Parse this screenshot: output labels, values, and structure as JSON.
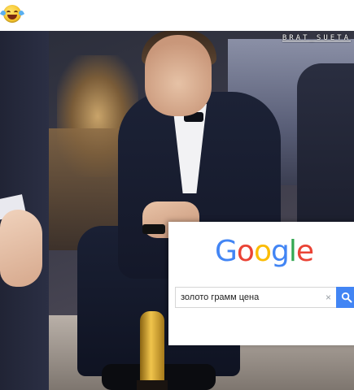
{
  "header": {
    "emoji_icon": "face-with-tears-of-joy-icon"
  },
  "photo": {
    "watermark": "BRAT_SUETA"
  },
  "google_overlay": {
    "logo_letters": [
      "G",
      "o",
      "o",
      "g",
      "l",
      "e"
    ],
    "search_query": "золото грамм цена",
    "clear_icon": "×",
    "search_button_icon": "search-icon",
    "colors": {
      "blue": "#4285f4",
      "red": "#ea4335",
      "yellow": "#fbbc05",
      "green": "#34a853"
    }
  }
}
